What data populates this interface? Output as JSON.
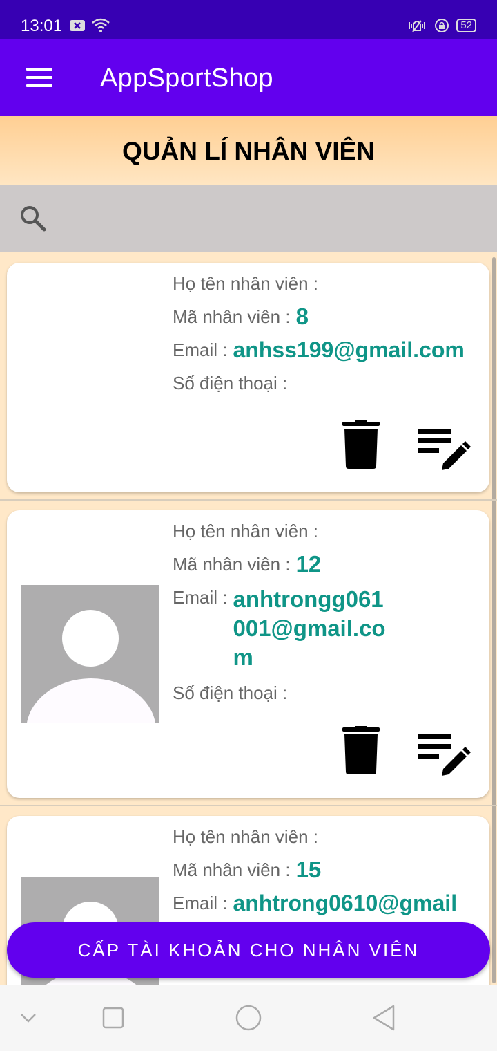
{
  "status_bar": {
    "time": "13:01",
    "battery": "52"
  },
  "app_bar": {
    "title": "AppSportShop"
  },
  "page": {
    "title": "QUẢN LÍ NHÂN VIÊN"
  },
  "search": {
    "placeholder": ""
  },
  "labels": {
    "name": "Họ tên nhân viên :",
    "code": "Mã nhân viên :",
    "email": "Email :",
    "phone": "Số điện thoại :"
  },
  "employees": [
    {
      "name": "",
      "code": "8",
      "email": "anhss199@gmail.com",
      "phone": ""
    },
    {
      "name": "",
      "code": "12",
      "email": "anhtrongg061001@gmail.com",
      "phone": ""
    },
    {
      "name": "",
      "code": "15",
      "email": "anhtrong0610@gmail",
      "phone": ""
    }
  ],
  "actions": {
    "create_account": "CẤP TÀI KHOẢN CHO NHÂN VIÊN"
  },
  "colors": {
    "primary": "#6200ee",
    "status_bar": "#3700b3",
    "accent_text": "#0f9587"
  }
}
